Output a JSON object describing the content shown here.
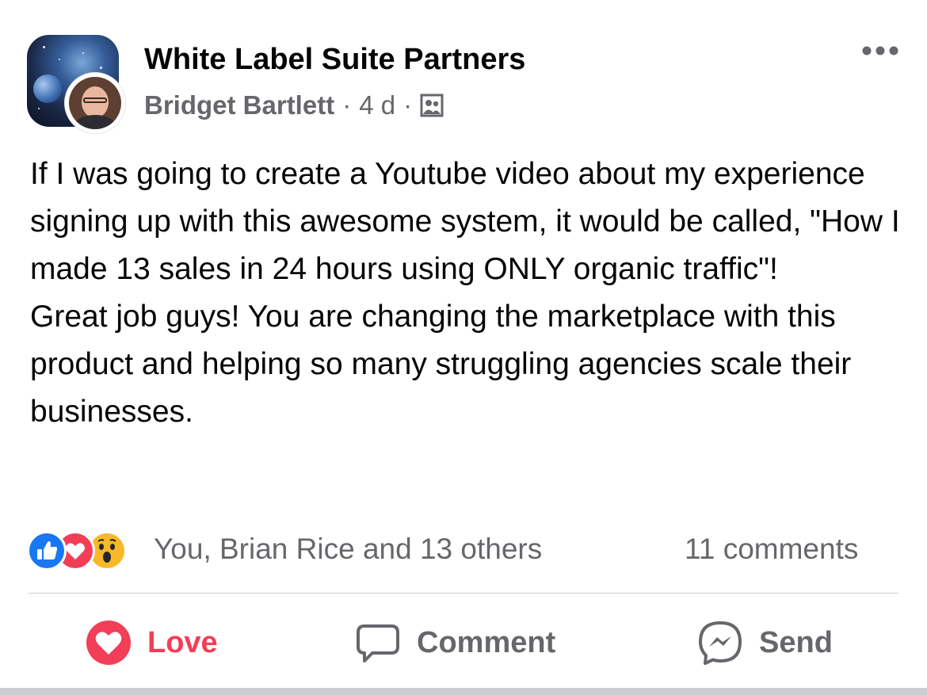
{
  "post": {
    "group_name": "White Label Suite Partners",
    "author": "Bridget Bartlett",
    "separator": "·",
    "timestamp": "4 d",
    "privacy_icon": "group-members-icon",
    "more_icon": "more-options-icon",
    "paragraphs": [
      "If I was going to create a Youtube video about my experience signing up with this awesome system, it would be called, \"How I made 13 sales in 24 hours using ONLY organic traffic\"!",
      "Great job guys! You are changing the marketplace with this product and helping so many struggling agencies scale their businesses."
    ]
  },
  "reactions": {
    "types": [
      "like",
      "love",
      "wow"
    ],
    "summary": "You, Brian Rice and 13 others",
    "comments": "11 comments"
  },
  "actions": {
    "love_label": "Love",
    "comment_label": "Comment",
    "send_label": "Send"
  },
  "colors": {
    "love": "#f33e58",
    "like": "#1877f2",
    "wow": "#f7b928",
    "secondary_text": "#65676b",
    "primary_text": "#050505"
  }
}
